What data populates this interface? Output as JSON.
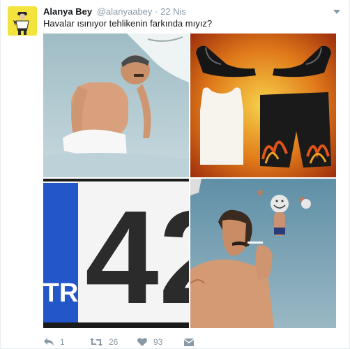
{
  "tweet": {
    "name": "Alanya Bey",
    "handle": "@alanyaabey",
    "separator": "·",
    "date": "22 Nis",
    "text": "Havalar ısınıyor tehlikenin farkında mıyız?"
  },
  "plate": {
    "country_code": "TR",
    "number": "42"
  },
  "actions": {
    "reply_count": "1",
    "retweet_count": "26",
    "like_count": "93"
  },
  "icons": {
    "caret": "chevron-down-icon",
    "reply": "reply-icon",
    "retweet": "retweet-icon",
    "like": "heart-icon",
    "dm": "envelope-icon"
  },
  "colors": {
    "action_gray": "#8899a6",
    "text": "#14171a",
    "plate_blue": "#2356c8",
    "avatar_bg": "#f4e33d"
  }
}
